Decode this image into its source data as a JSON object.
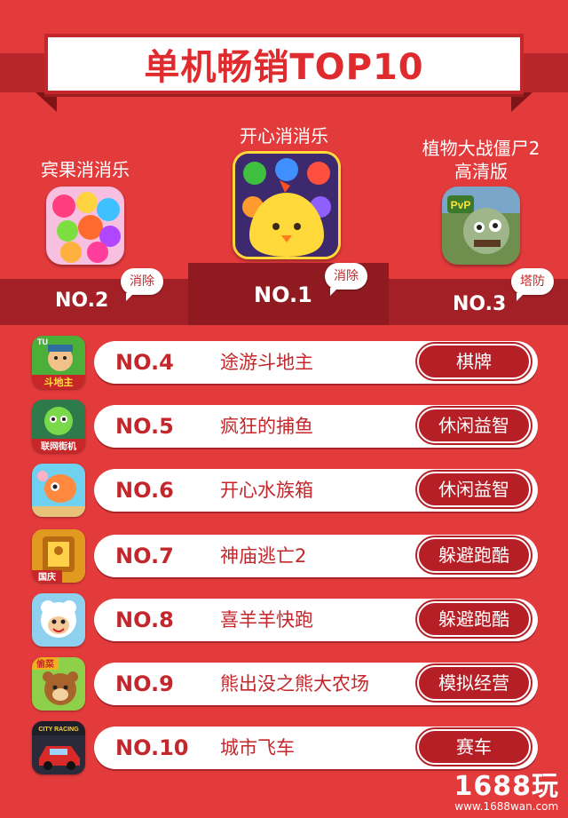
{
  "title": "单机畅销TOP10",
  "top3": [
    {
      "rank": "NO.2",
      "name": "宾果消消乐",
      "tag": "消除",
      "icon": "candy-game-icon"
    },
    {
      "rank": "NO.1",
      "name": "开心消消乐",
      "tag": "消除",
      "icon": "yellow-chick-icon"
    },
    {
      "rank": "NO.3",
      "name_line1": "植物大战僵尸2",
      "name_line2": "高清版",
      "tag": "塔防",
      "icon": "pvz-zombie-icon"
    }
  ],
  "list": [
    {
      "rank": "NO.4",
      "name": "途游斗地主",
      "tag": "棋牌",
      "icon": "doudizhu-icon",
      "icon_text": "斗地主",
      "corner": "TU"
    },
    {
      "rank": "NO.5",
      "name": "疯狂的捕鱼",
      "tag": "休闲益智",
      "icon": "fishing-icon",
      "icon_text": "联网街机"
    },
    {
      "rank": "NO.6",
      "name": "开心水族箱",
      "tag": "休闲益智",
      "icon": "aquarium-icon"
    },
    {
      "rank": "NO.7",
      "name": "神庙逃亡2",
      "tag": "躲避跑酷",
      "icon": "temple-run-icon",
      "icon_text": "国庆"
    },
    {
      "rank": "NO.8",
      "name": "喜羊羊快跑",
      "tag": "躲避跑酷",
      "icon": "sheep-icon"
    },
    {
      "rank": "NO.9",
      "name": "熊出没之熊大农场",
      "tag": "模拟经营",
      "icon": "bear-farm-icon",
      "icon_text": "偷菜"
    },
    {
      "rank": "NO.10",
      "name": "城市飞车",
      "tag": "赛车",
      "icon": "city-racing-icon",
      "icon_text": "CITY RACING"
    }
  ],
  "watermark": {
    "main": "1688玩",
    "url": "www.1688wan.com"
  },
  "colors": {
    "background": "#e33a3b",
    "dark_red": "#b51f25",
    "text_red": "#c4272b"
  }
}
